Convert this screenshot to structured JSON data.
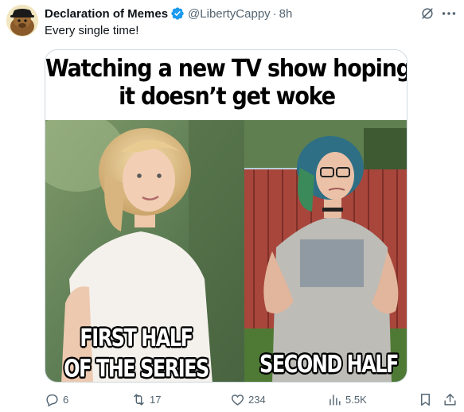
{
  "tweet": {
    "author": "Declaration of Memes",
    "handle": "@LibertyCappy",
    "separator": "·",
    "time": "8h",
    "text": "Every single time!"
  },
  "meme": {
    "caption_line1": "Watching a new TV show hoping",
    "caption_line2": "it doesn’t get woke",
    "left_label_line1": "FIRST HALF",
    "left_label_line2": "OF THE SERIES",
    "right_label": "SECOND HALF"
  },
  "actions": {
    "replies": "6",
    "retweets": "17",
    "likes": "234",
    "views": "5.5K"
  },
  "icons": {
    "verified": "verified-badge-icon",
    "grok": "grok-icon",
    "more": "more-icon",
    "reply": "reply-icon",
    "retweet": "retweet-icon",
    "like": "heart-icon",
    "views": "views-icon",
    "bookmark": "bookmark-icon",
    "share": "share-icon"
  },
  "colors": {
    "verified_blue": "#1d9bf0",
    "secondary_text": "#536471",
    "primary_text": "#0f1419"
  }
}
